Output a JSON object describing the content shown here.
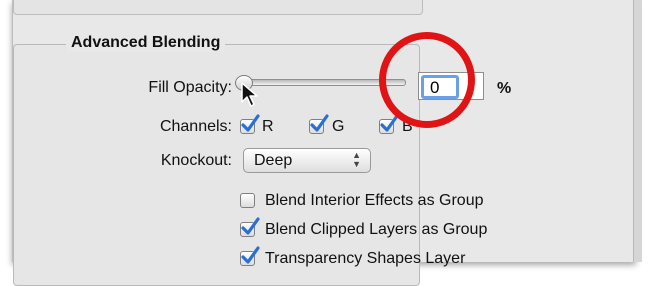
{
  "section": {
    "title": "Advanced Blending"
  },
  "fill_opacity": {
    "label": "Fill Opacity:",
    "value": "0",
    "unit": "%",
    "slider_fraction": 0.0
  },
  "channels": {
    "label": "Channels:",
    "items": [
      {
        "label": "R",
        "checked": true
      },
      {
        "label": "G",
        "checked": true
      },
      {
        "label": "B",
        "checked": true
      }
    ]
  },
  "knockout": {
    "label": "Knockout:",
    "selected": "Deep"
  },
  "options": [
    {
      "label": "Blend Interior Effects as Group",
      "checked": false
    },
    {
      "label": "Blend Clipped Layers as Group",
      "checked": true
    },
    {
      "label": "Transparency Shapes Layer",
      "checked": true
    }
  ],
  "colors": {
    "highlight_ring": "#e01414",
    "check_blue": "#2a6fd6",
    "focus_ring": "#6aa0e8"
  }
}
